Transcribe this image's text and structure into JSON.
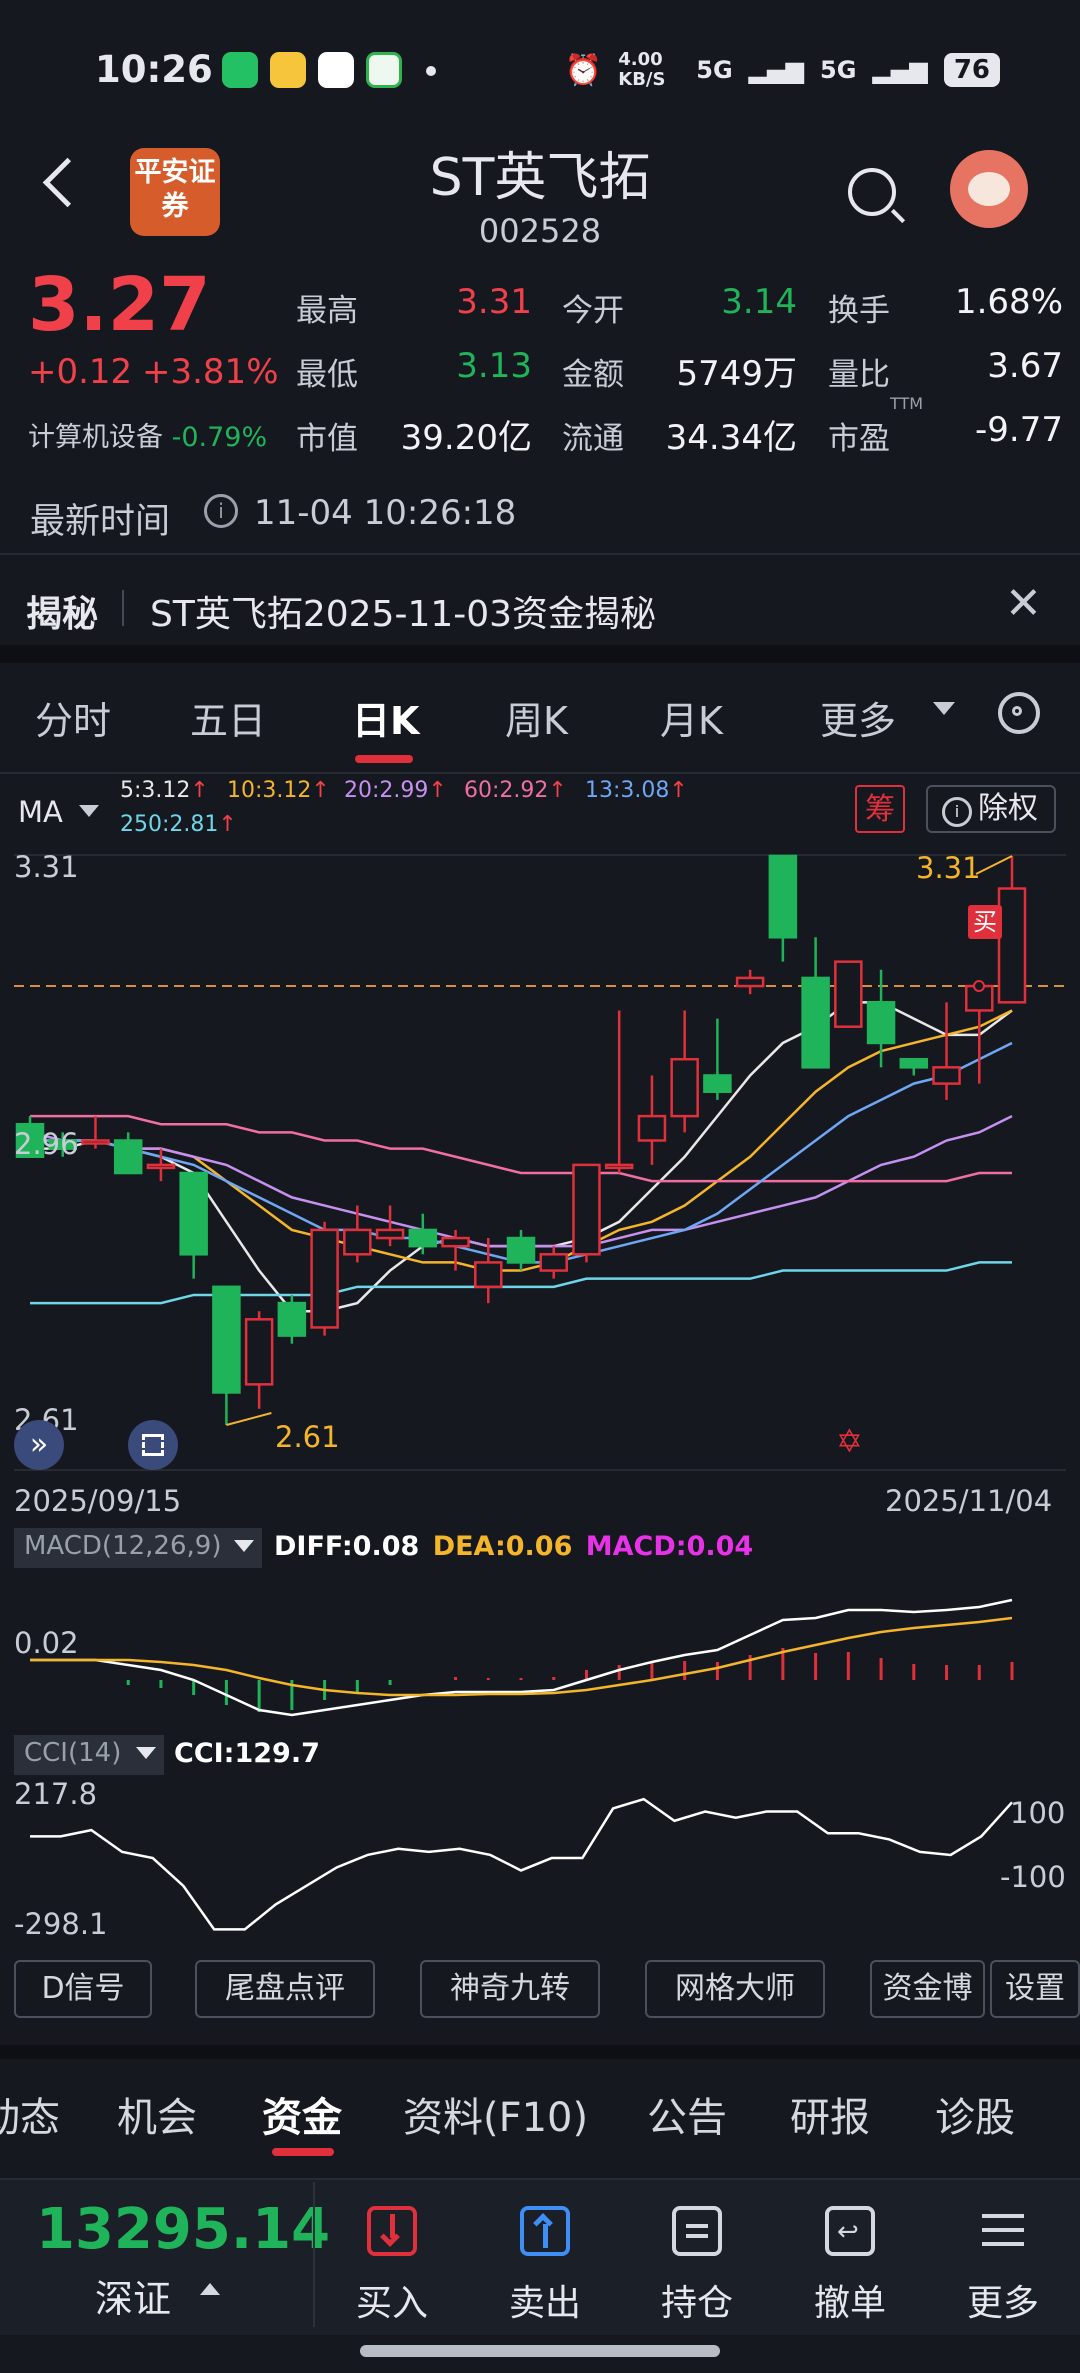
{
  "status_bar": {
    "time": "10:26",
    "net_speed": "4.00 KB/S",
    "signal_1": "5G",
    "signal_2": "5G",
    "battery": "76"
  },
  "header": {
    "logo_text": "平安证券",
    "stock_name": "ST英飞拓",
    "stock_code": "002528"
  },
  "quote": {
    "price": "3.27",
    "change": "+0.12",
    "change_pct": "+3.81%",
    "industry": "计算机设备",
    "industry_change": "-0.79%",
    "stats": [
      {
        "label": "最高",
        "value": "3.31",
        "tone": "red"
      },
      {
        "label": "今开",
        "value": "3.14",
        "tone": "green"
      },
      {
        "label": "换手",
        "value": "1.68%",
        "tone": "white"
      },
      {
        "label": "最低",
        "value": "3.13",
        "tone": "green"
      },
      {
        "label": "金额",
        "value": "5749万",
        "tone": "white"
      },
      {
        "label": "量比",
        "value": "3.67",
        "tone": "white"
      },
      {
        "label": "市值",
        "value": "39.20亿",
        "tone": "white"
      },
      {
        "label": "流通",
        "value": "34.34亿",
        "tone": "white"
      },
      {
        "label": "市盈",
        "value": "-9.77",
        "tone": "white"
      }
    ],
    "pe_suffix": "TTM",
    "latest_time_label": "最新时间",
    "latest_time": "11-04 10:26:18"
  },
  "reveal": {
    "label": "揭秘",
    "text": "ST英飞拓2025-11-03资金揭秘"
  },
  "period_tabs": [
    "分时",
    "五日",
    "日K",
    "周K",
    "月K",
    "更多"
  ],
  "ma_legend": {
    "label": "MA",
    "items": [
      {
        "text": "5:3.12",
        "color": "#e8e8e8"
      },
      {
        "text": "10:3.12",
        "color": "#f5b52a"
      },
      {
        "text": "20:2.99",
        "color": "#c690ef"
      },
      {
        "text": "60:2.92",
        "color": "#f06fa0"
      },
      {
        "text": "13:3.08",
        "color": "#6fa7f5"
      },
      {
        "text": "250:2.81",
        "color": "#6fd6e8"
      }
    ],
    "arrow": "↑",
    "chip_label": "筹",
    "fq_label": "除权"
  },
  "chart_data": {
    "type": "candlestick",
    "y_max_label": "3.31",
    "y_mid_label": "2.96",
    "y_min_label": "2.61",
    "ylim": [
      2.61,
      3.31
    ],
    "x_start": "2025/09/15",
    "x_end": "2025/11/04",
    "high_marker": "3.31",
    "low_marker": "2.61",
    "buy_marker": "买",
    "ref_price": 3.15,
    "candles": [
      {
        "o": 2.98,
        "c": 2.94,
        "h": 2.99,
        "l": 2.94
      },
      {
        "o": 2.96,
        "c": 2.95,
        "h": 2.97,
        "l": 2.94
      },
      {
        "o": 2.96,
        "c": 2.96,
        "h": 2.99,
        "l": 2.95
      },
      {
        "o": 2.96,
        "c": 2.92,
        "h": 2.97,
        "l": 2.92
      },
      {
        "o": 2.93,
        "c": 2.93,
        "h": 2.95,
        "l": 2.91
      },
      {
        "o": 2.92,
        "c": 2.82,
        "h": 2.92,
        "l": 2.79
      },
      {
        "o": 2.78,
        "c": 2.65,
        "h": 2.78,
        "l": 2.61
      },
      {
        "o": 2.66,
        "c": 2.74,
        "h": 2.75,
        "l": 2.63
      },
      {
        "o": 2.76,
        "c": 2.72,
        "h": 2.77,
        "l": 2.71
      },
      {
        "o": 2.73,
        "c": 2.85,
        "h": 2.86,
        "l": 2.72
      },
      {
        "o": 2.82,
        "c": 2.85,
        "h": 2.88,
        "l": 2.81
      },
      {
        "o": 2.84,
        "c": 2.85,
        "h": 2.88,
        "l": 2.83
      },
      {
        "o": 2.85,
        "c": 2.83,
        "h": 2.87,
        "l": 2.82
      },
      {
        "o": 2.83,
        "c": 2.84,
        "h": 2.85,
        "l": 2.8
      },
      {
        "o": 2.78,
        "c": 2.81,
        "h": 2.84,
        "l": 2.76
      },
      {
        "o": 2.84,
        "c": 2.81,
        "h": 2.85,
        "l": 2.8
      },
      {
        "o": 2.8,
        "c": 2.82,
        "h": 2.83,
        "l": 2.79
      },
      {
        "o": 2.82,
        "c": 2.93,
        "h": 2.93,
        "l": 2.81
      },
      {
        "o": 2.93,
        "c": 2.93,
        "h": 3.12,
        "l": 2.92
      },
      {
        "o": 2.96,
        "c": 2.99,
        "h": 3.04,
        "l": 2.93
      },
      {
        "o": 2.99,
        "c": 3.06,
        "h": 3.12,
        "l": 2.97
      },
      {
        "o": 3.04,
        "c": 3.02,
        "h": 3.11,
        "l": 3.01
      },
      {
        "o": 3.15,
        "c": 3.16,
        "h": 3.17,
        "l": 3.14
      },
      {
        "o": 3.31,
        "c": 3.21,
        "h": 3.31,
        "l": 3.18
      },
      {
        "o": 3.16,
        "c": 3.05,
        "h": 3.21,
        "l": 3.05
      },
      {
        "o": 3.1,
        "c": 3.18,
        "h": 3.18,
        "l": 3.1
      },
      {
        "o": 3.13,
        "c": 3.08,
        "h": 3.17,
        "l": 3.05
      },
      {
        "o": 3.06,
        "c": 3.05,
        "h": 3.06,
        "l": 3.04
      },
      {
        "o": 3.03,
        "c": 3.05,
        "h": 3.13,
        "l": 3.01
      },
      {
        "o": 3.12,
        "c": 3.15,
        "h": 3.15,
        "l": 3.03
      },
      {
        "o": 3.13,
        "c": 3.27,
        "h": 3.31,
        "l": 3.13
      }
    ],
    "ma_lines": [
      {
        "name": "MA5",
        "color": "#e8e8e8",
        "values": [
          2.95,
          2.95,
          2.96,
          2.95,
          2.94,
          2.92,
          2.86,
          2.8,
          2.75,
          2.75,
          2.76,
          2.8,
          2.83,
          2.84,
          2.83,
          2.83,
          2.83,
          2.84,
          2.86,
          2.9,
          2.94,
          2.99,
          3.04,
          3.08,
          3.1,
          3.13,
          3.13,
          3.11,
          3.09,
          3.09,
          3.12
        ]
      },
      {
        "name": "MA10",
        "color": "#f5b52a",
        "values": [
          2.96,
          2.96,
          2.96,
          2.95,
          2.95,
          2.94,
          2.91,
          2.88,
          2.85,
          2.84,
          2.83,
          2.82,
          2.81,
          2.81,
          2.8,
          2.8,
          2.81,
          2.83,
          2.85,
          2.86,
          2.88,
          2.91,
          2.94,
          2.98,
          3.02,
          3.05,
          3.07,
          3.08,
          3.09,
          3.1,
          3.12
        ]
      },
      {
        "name": "MA20",
        "color": "#c690ef",
        "values": [
          2.97,
          2.96,
          2.96,
          2.95,
          2.95,
          2.94,
          2.93,
          2.91,
          2.89,
          2.88,
          2.87,
          2.86,
          2.85,
          2.84,
          2.83,
          2.83,
          2.83,
          2.83,
          2.84,
          2.85,
          2.85,
          2.86,
          2.87,
          2.88,
          2.89,
          2.91,
          2.93,
          2.94,
          2.96,
          2.97,
          2.99
        ]
      },
      {
        "name": "MA60",
        "color": "#f06fa0",
        "values": [
          2.99,
          2.99,
          2.99,
          2.99,
          2.98,
          2.98,
          2.98,
          2.97,
          2.97,
          2.96,
          2.96,
          2.95,
          2.95,
          2.94,
          2.93,
          2.92,
          2.92,
          2.92,
          2.92,
          2.91,
          2.91,
          2.91,
          2.91,
          2.91,
          2.91,
          2.91,
          2.91,
          2.91,
          2.91,
          2.92,
          2.92
        ]
      },
      {
        "name": "MA13",
        "color": "#6fa7f5",
        "values": [
          2.96,
          2.96,
          2.96,
          2.95,
          2.94,
          2.93,
          2.91,
          2.89,
          2.87,
          2.85,
          2.85,
          2.84,
          2.84,
          2.83,
          2.82,
          2.81,
          2.81,
          2.82,
          2.83,
          2.84,
          2.85,
          2.87,
          2.9,
          2.93,
          2.96,
          2.99,
          3.01,
          3.03,
          3.04,
          3.06,
          3.08
        ]
      },
      {
        "name": "MA250",
        "color": "#6fd6e8",
        "values": [
          2.76,
          2.76,
          2.76,
          2.76,
          2.76,
          2.77,
          2.77,
          2.77,
          2.77,
          2.77,
          2.78,
          2.78,
          2.78,
          2.78,
          2.78,
          2.78,
          2.78,
          2.79,
          2.79,
          2.79,
          2.79,
          2.79,
          2.79,
          2.8,
          2.8,
          2.8,
          2.8,
          2.8,
          2.8,
          2.81,
          2.81
        ]
      }
    ],
    "macd": {
      "label": "MACD(12,26,9)",
      "diff_label": "DIFF:0.08",
      "dea_label": "DEA:0.06",
      "macd_label": "MACD:0.04",
      "y_label": "0.02",
      "diff": [
        0.02,
        0.02,
        0.02,
        0.015,
        0.01,
        0.0,
        -0.015,
        -0.03,
        -0.035,
        -0.03,
        -0.025,
        -0.02,
        -0.015,
        -0.012,
        -0.012,
        -0.012,
        -0.01,
        0.0,
        0.01,
        0.018,
        0.025,
        0.03,
        0.045,
        0.06,
        0.062,
        0.07,
        0.07,
        0.068,
        0.07,
        0.073,
        0.08
      ],
      "dea": [
        0.02,
        0.02,
        0.02,
        0.02,
        0.018,
        0.015,
        0.01,
        0.002,
        -0.005,
        -0.01,
        -0.013,
        -0.015,
        -0.015,
        -0.015,
        -0.014,
        -0.014,
        -0.013,
        -0.01,
        -0.005,
        0.0,
        0.006,
        0.012,
        0.02,
        0.028,
        0.035,
        0.042,
        0.048,
        0.052,
        0.055,
        0.058,
        0.062
      ],
      "hist": [
        0.0,
        0.0,
        0.0,
        -0.005,
        -0.008,
        -0.015,
        -0.025,
        -0.032,
        -0.03,
        -0.02,
        -0.012,
        -0.005,
        0.0,
        0.003,
        0.002,
        0.002,
        0.003,
        0.01,
        0.015,
        0.018,
        0.019,
        0.018,
        0.025,
        0.032,
        0.027,
        0.028,
        0.022,
        0.016,
        0.015,
        0.015,
        0.018
      ]
    },
    "cci": {
      "label": "CCI(14)",
      "value_label": "CCI:129.7",
      "y_top": "217.8",
      "y_bottom": "-298.1",
      "level_hi": "100",
      "level_lo": "-100",
      "values": [
        20,
        20,
        40,
        -30,
        -50,
        -140,
        -280,
        -280,
        -200,
        -140,
        -80,
        -40,
        -20,
        -30,
        -20,
        -40,
        -90,
        -50,
        -50,
        110,
        140,
        70,
        100,
        80,
        100,
        100,
        30,
        30,
        10,
        -30,
        -40,
        20,
        129.7
      ]
    }
  },
  "feature_buttons": [
    "D信号",
    "尾盘点评",
    "神奇九转",
    "网格大师",
    "资金博",
    "设置"
  ],
  "bottom_tabs": [
    "动态",
    "机会",
    "资金",
    "资料(F10)",
    "公告",
    "研报",
    "诊股"
  ],
  "footer": {
    "index_value": "13295.14",
    "index_name": "深证",
    "actions": [
      {
        "label": "买入",
        "icon": "buy-icon"
      },
      {
        "label": "卖出",
        "icon": "sell-icon"
      },
      {
        "label": "持仓",
        "icon": "holdings-icon"
      },
      {
        "label": "撤单",
        "icon": "cancel-order-icon"
      },
      {
        "label": "更多",
        "icon": "more-icon"
      }
    ]
  }
}
